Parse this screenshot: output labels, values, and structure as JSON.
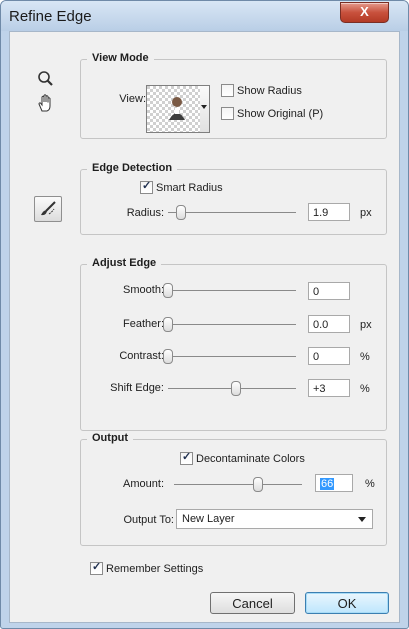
{
  "window": {
    "title": "Refine Edge",
    "close_label": "X"
  },
  "tools": [
    "zoom-tool-icon",
    "hand-tool-icon",
    "refine-radius-brush-icon"
  ],
  "view_mode": {
    "title": "View Mode",
    "view_label": "View:",
    "show_radius": {
      "label": "Show Radius",
      "checked": false
    },
    "show_original": {
      "label": "Show Original (P)",
      "checked": false
    }
  },
  "edge_detection": {
    "title": "Edge Detection",
    "smart_radius": {
      "label": "Smart Radius",
      "checked": true
    },
    "radius": {
      "label": "Radius:",
      "value": "1.9",
      "unit": "px",
      "level": 0.1
    }
  },
  "adjust_edge": {
    "title": "Adjust Edge",
    "smooth": {
      "label": "Smooth:",
      "value": "0",
      "unit": "",
      "level": 0.0
    },
    "feather": {
      "label": "Feather:",
      "value": "0.0",
      "unit": "px",
      "level": 0.0
    },
    "contrast": {
      "label": "Contrast:",
      "value": "0",
      "unit": "%",
      "level": 0.0
    },
    "shift_edge": {
      "label": "Shift Edge:",
      "value": "+3",
      "unit": "%",
      "level": 0.53
    }
  },
  "output": {
    "title": "Output",
    "decontaminate": {
      "label": "Decontaminate Colors",
      "checked": true
    },
    "amount": {
      "label": "Amount:",
      "value": "66",
      "unit": "%",
      "level": 0.66
    },
    "output_to": {
      "label": "Output To:",
      "value": "New Layer"
    }
  },
  "remember_settings": {
    "label": "Remember Settings",
    "checked": true
  },
  "buttons": {
    "cancel": "Cancel",
    "ok": "OK"
  },
  "colors": {
    "accent": "#3399ff",
    "close_button": "#c8513d",
    "frame": "#bfd3ea"
  }
}
